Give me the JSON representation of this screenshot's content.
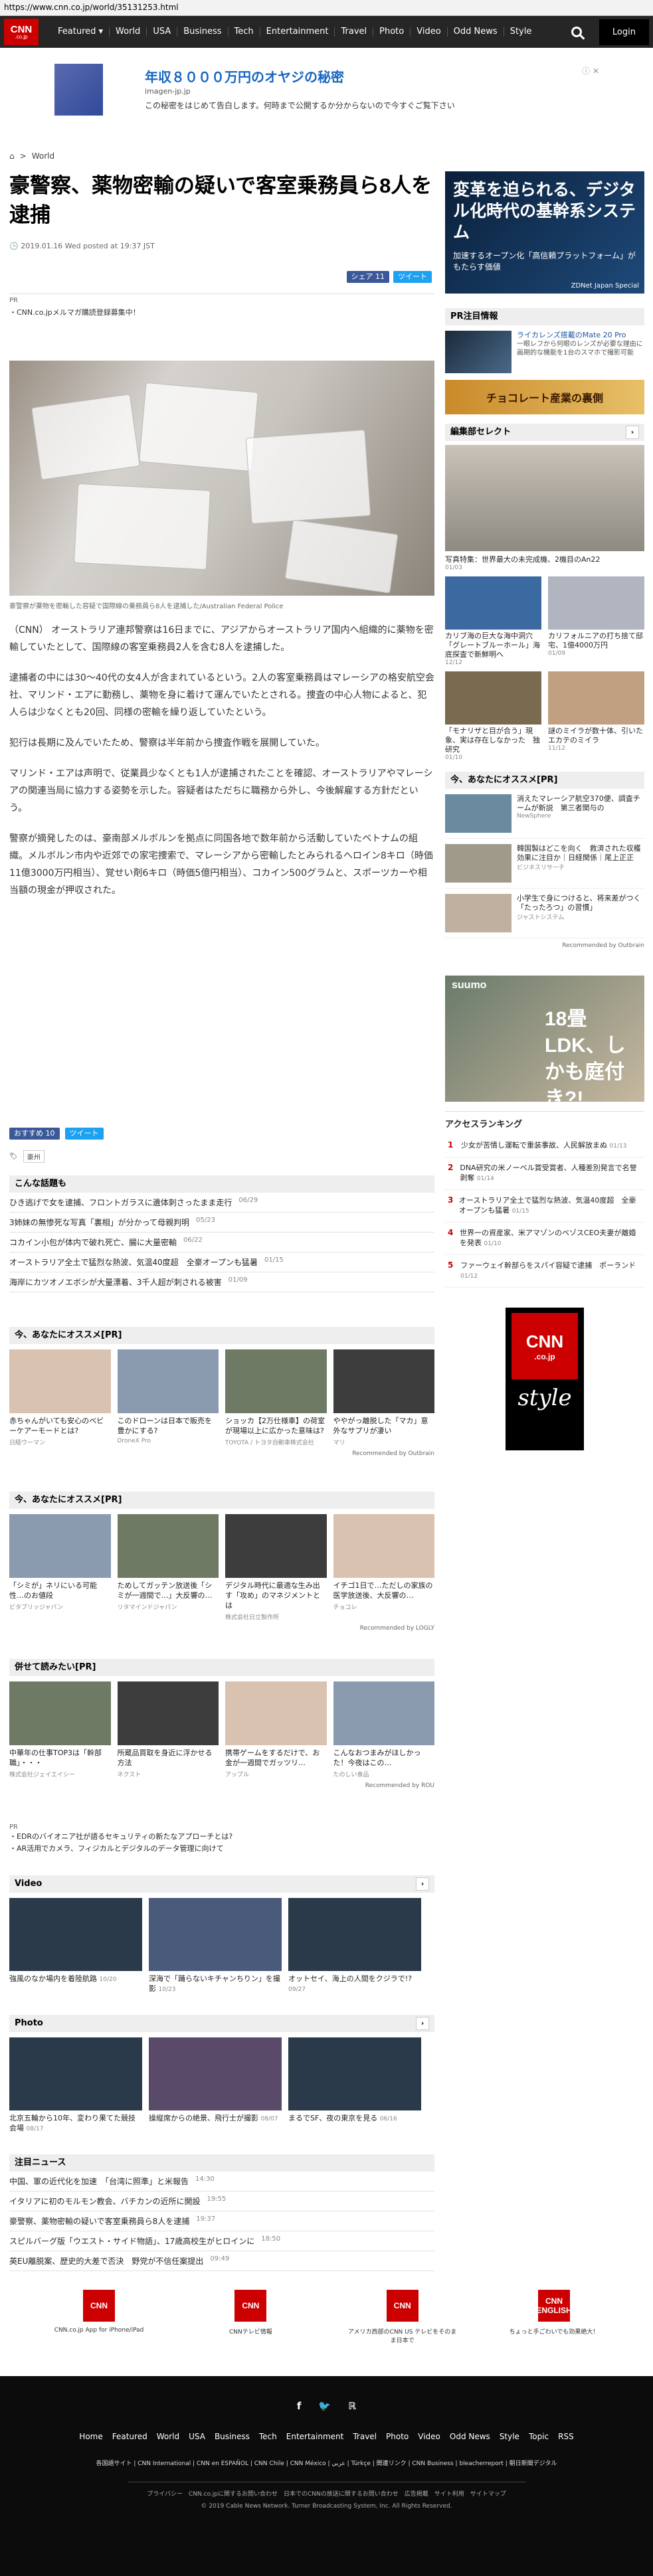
{
  "browser": {
    "url": "https://www.cnn.co.jp/world/35131253.html"
  },
  "nav": {
    "logo": "CNN",
    "logo_sub": ".co.jp",
    "items": [
      "Featured ▾",
      "World",
      "USA",
      "Business",
      "Tech",
      "Entertainment",
      "Travel",
      "Photo",
      "Video",
      "Odd News",
      "Style"
    ],
    "login": "Login"
  },
  "ad_top": {
    "title": "年収８０００万円のオヤジの秘密",
    "source": "imagen-jp.jp",
    "desc": "この秘密をはじめて告白します。何時まで公開するか分からないので今すぐご覧下さい"
  },
  "breadcrumb": {
    "home": "⌂",
    "section": "World"
  },
  "article": {
    "headline": "豪警察、薬物密輸の疑いで客室乗務員ら8人を逮捕",
    "date": "2019.01.16 Wed posted at 19:37 JST",
    "share_fb": "シェア 11",
    "share_tw": "ツイート",
    "pr_label": "PR",
    "pr_text": "・CNN.co.jpメルマガ購読登録募集中！",
    "caption": "豪警察が薬物を密輸した容疑で国際線の乗務員ら8人を逮捕した/Australian Federal Police",
    "paragraphs": [
      "（CNN） オーストラリア連邦警察は16日までに、アジアからオーストラリア国内へ組織的に薬物を密輸していたとして、国際線の客室乗務員2人を含む8人を逮捕した。",
      "逮捕者の中には30～40代の女4人が含まれているという。2人の客室乗務員はマレーシアの格安航空会社、マリンド・エアに勤務し、薬物を身に着けて運んでいたとされる。捜査の中心人物によると、犯人らは少なくとも20回、同様の密輸を繰り返していたという。",
      "犯行は長期に及んでいたため、警察は半年前から捜査作戦を展開していた。",
      "マリンド・エアは声明で、従業員少なくとも1人が逮捕されたことを確認、オーストラリアやマレーシアの関連当局に協力する姿勢を示した。容疑者はただちに職務から外し、今後解雇する方針だという。",
      "警察が摘発したのは、豪南部メルボルンを拠点に同国各地で数年前から活動していたベトナムの組織。メルボルン市内や近郊での家宅捜索で、マレーシアから密輸したとみられるヘロイン8キロ（時価11億3000万円相当）、覚せい剤6キロ（時価5億円相当）、コカイン500グラムと、スポーツカーや相当額の現金が押収された。"
    ],
    "like": "おすすめ 10",
    "tweet": "ツイート",
    "tag": "豪州"
  },
  "hot": {
    "title": "こんな話題も",
    "items": [
      {
        "t": "ひき逃げで女を逮捕、フロントガラスに遺体刺さったまま走行",
        "d": "06/29"
      },
      {
        "t": "3姉妹の無惨死な写真「裏相」が分かって母親判明",
        "d": "05/23"
      },
      {
        "t": "コカイン小包が体内で破れ死亡、腸に大量密輸",
        "d": "06/22"
      },
      {
        "t": "オーストラリア全土で猛烈な熱波、気温40度超　全豪オープンも猛暑",
        "d": "01/15"
      },
      {
        "t": "海岸にカツオノエボシが大量漂着、3千人超が刺される被害",
        "d": "01/09"
      }
    ]
  },
  "rec1": {
    "title": "今、あなたにオススメ[PR]",
    "items": [
      {
        "t": "赤ちゃんがいても安心のベビーケアーモードとは?",
        "s": "日経ウーマン"
      },
      {
        "t": "このドローンは日本で販売を豊かにする?",
        "s": "DroneX Pro"
      },
      {
        "t": "ショッカ【2万仕様車】の荷室が現場以上に広かった意味は?",
        "s": "TOYOTA / トヨタ自動車株式会社"
      },
      {
        "t": "ややがっ離脱した「マカ」意外なサプリが凄い",
        "s": "マリ"
      }
    ],
    "byline": "Recommended by Outbrain"
  },
  "rec2": {
    "title": "今、あなたにオススメ[PR]",
    "items": [
      {
        "t": "「シミが」ネリにいる可能性…のお値段",
        "s": "ビタブリッジャパン"
      },
      {
        "t": "ためしてガッテン放送後「シミが一週間で…」大反響の…",
        "s": "リタマインドジャパン"
      },
      {
        "t": "デジタル時代に最適な生み出す「攻め」のマネジメントとは",
        "s": "株式会社日立製作所"
      },
      {
        "t": "イチゴ1日で…ただしの家族の医学放送後、大反響の…",
        "s": "チョコレ"
      }
    ],
    "byline": "Recommended by LOGLY"
  },
  "rec3": {
    "title": "併せて読みたい[PR]",
    "items": [
      {
        "t": "中華年の仕事TOP3は「幹部職」・・・",
        "s": "株式会社ジェイエイシー"
      },
      {
        "t": "所蔵品買取を身近に浮かせる方法",
        "s": "ネクスト"
      },
      {
        "t": "携帯ゲームをするだけで、お金が一週間でガッツリ…",
        "s": "アップル"
      },
      {
        "t": "こんなおつまみがほしかった！今夜はこの…",
        "s": "たのしい食品"
      }
    ],
    "byline": "Recommended by ROU"
  },
  "pr_links": {
    "label": "PR",
    "items": [
      "・EDRのバイオニア社が語るセキュリティの新たなアプローチとは?",
      "・AR活用でカメラ、フィジカルとデジタルのデータ管理に向けて"
    ]
  },
  "video": {
    "title": "Video",
    "items": [
      {
        "t": "強風のなか場内を着陸航路",
        "d": "10/20"
      },
      {
        "t": "深海で「踊らないキチャンちりン」を撮影",
        "d": "10/23"
      },
      {
        "t": "オットセイ、海上の人間をクジラで!?",
        "d": "09/27"
      }
    ]
  },
  "photo": {
    "title": "Photo",
    "items": [
      {
        "t": "北京五輪から10年、変わり果てた競技会場",
        "d": "08/17"
      },
      {
        "t": "操縦席からの絶景、飛行士が撮影",
        "d": "08/07"
      },
      {
        "t": "まるでSF、夜の東京を見る",
        "d": "06/16"
      }
    ]
  },
  "news": {
    "title": "注目ニュース",
    "items": [
      {
        "t": "中国、軍の近代化を加速　「台湾に照準」と米報告",
        "d": "14:30"
      },
      {
        "t": "イタリアに初のモルモン教会、バチカンの近所に開設",
        "d": "19:55"
      },
      {
        "t": "豪警察、薬物密輸の疑いで客室乗務員ら8人を逮捕",
        "d": "19:37"
      },
      {
        "t": "スピルバーグ版「ウエスト・サイド物語」、17歳高校生がヒロインに",
        "d": "18:50"
      },
      {
        "t": "英EU離脱案、歴史的大差で否決　野党が不信任案提出",
        "d": "09:49"
      }
    ]
  },
  "side": {
    "ad": {
      "headline": "変革を迫られる、デジタル化時代の基幹系システム",
      "sub": "加速するオープン化「高信頼プラットフォーム」がもたらす価値",
      "foot": "ZDNet Japan Special"
    },
    "pr": {
      "title": "PR注目情報",
      "items": [
        {
          "t": "ライカレンズ搭載のMate 20 Pro",
          "d": "一眼レフから何眼のレンズが必要な理由に画期的な機能を1台のスマホで撮影可能"
        },
        {
          "t": "チョコレート産業の裏側",
          "d": ""
        }
      ]
    },
    "edit": {
      "title": "編集部セレクト",
      "main": {
        "t": "写真特集：世界最大の未完成機、2機目のAn22",
        "d": "01/03"
      },
      "items": [
        {
          "t": "カリブ海の巨大な海中洞穴「グレートブルーホール」海底探査で新鮮明へ",
          "d": "12/12"
        },
        {
          "t": "カリフォルニアの打ち捨て邸宅、1億4000万円",
          "d": "01/09"
        },
        {
          "t": "「モナリザと目が合う」現象、実は存在しなかった　独研究",
          "d": "01/10"
        },
        {
          "t": "謎のミイラが数十体、引いたエカテのミイラ",
          "d": "11/12"
        }
      ]
    },
    "osusume": {
      "title": "今、あなたにオススメ[PR]",
      "items": [
        {
          "t": "消えたマレーシア航空370便、調査チームが新説　第三者関与の",
          "s": "NewSphere"
        },
        {
          "t": "韓国製はどこを向く　救済された収穫効果に注目か｜日経関係｜尾上正正",
          "s": "ビジネスリサーチ"
        },
        {
          "t": "小学生で身につけると、将来差がつく「たったろつ」の習慣」",
          "s": "ジャストシステム"
        }
      ],
      "byline": "Recommended by Outbrain"
    },
    "suumo": {
      "logo": "suumo",
      "headline": "18畳LDK、しかも庭付き?!"
    },
    "ranking": {
      "title": "アクセスランキング",
      "items": [
        {
          "t": "少女が苦情し運転で重装事故、人民解放まぬ",
          "d": "01/13"
        },
        {
          "t": "DNA研究の米ノーベル賞受賞者、人種差別発言で名誉剥奪",
          "d": "01/14"
        },
        {
          "t": "オーストラリア全土で猛烈な熱波、気温40度超　全豪オープンも猛暑",
          "d": "01/15"
        },
        {
          "t": "世界一の資産家、米アマゾンのベゾスCEO夫妻が離婚を発表",
          "d": "01/10"
        },
        {
          "t": "ファーウェイ幹部らをスパイ容疑で逮捕　ポーランド",
          "d": "01/12"
        }
      ]
    },
    "style": {
      "logo": "CNN",
      "logo_sub": ".co.jp",
      "word": "style"
    }
  },
  "apps": [
    {
      "icon": "CNN",
      "label": "CNN.co.jp App for iPhone/iPad"
    },
    {
      "icon": "CNN",
      "label": "CNNテレビ情報"
    },
    {
      "icon": "CNN",
      "label": "アメリカ西部のCNN US テレビをそのまま日本で"
    },
    {
      "icon": "CNN ENGLISH",
      "label": "ちょっと手ごわいでも効果絶大！"
    }
  ],
  "footer": {
    "social": [
      "f",
      "🐦",
      "ℝ"
    ],
    "nav": [
      "Home",
      "Featured",
      "World",
      "USA",
      "Business",
      "Tech",
      "Entertainment",
      "Travel",
      "Photo",
      "Video",
      "Odd News",
      "Style",
      "Topic",
      "RSS"
    ],
    "sub1": "各国語サイト | CNN International | CNN en ESPAÑOL | CNN Chile | CNN México | عربي | Türkçe | 関連リンク | CNN Business | bleacherreport | 朝日新聞デジタル",
    "sub2": "プライバシー　CNN.co.jpに関するお問い合わせ　日本でのCNNの放送に関するお問い合わせ　広告掲載　サイト利用　サイトマップ",
    "copy": "© 2019 Cable News Network. Turner Broadcasting System, Inc. All Rights Reserved."
  }
}
